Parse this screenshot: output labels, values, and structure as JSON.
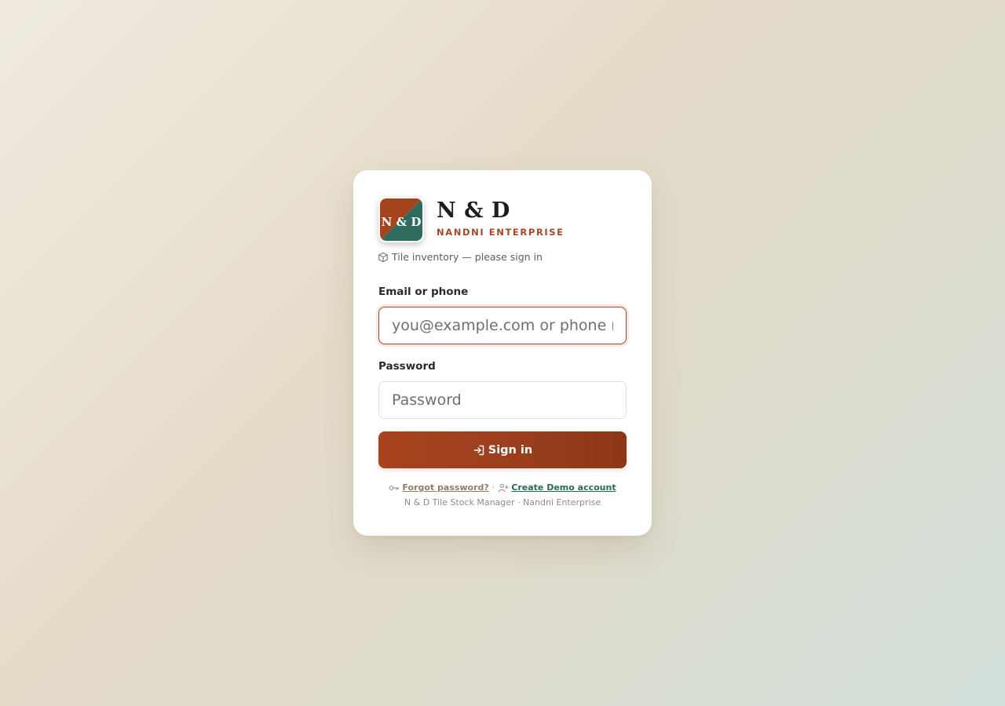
{
  "brand": {
    "logo_text": "N & D",
    "name": "N & D",
    "subtitle": "NANDNI ENTERPRISE",
    "colors": {
      "primary": "#a4482a",
      "secondary": "#2f6b5d"
    }
  },
  "tagline": {
    "icon": "cube-icon",
    "text": "Tile inventory — please sign in"
  },
  "form": {
    "email": {
      "label": "Email or phone",
      "placeholder": "you@example.com or phone number",
      "value": ""
    },
    "password": {
      "label": "Password",
      "placeholder": "Password",
      "value": ""
    },
    "submit": {
      "icon": "sign-in-icon",
      "label": "Sign in"
    }
  },
  "footer": {
    "forgot": {
      "icon": "key-icon",
      "label": "Forgot password?"
    },
    "separator": "·",
    "demo": {
      "icon": "add-user-icon",
      "label": "Create Demo account"
    },
    "note": "N & D Tile Stock Manager · Nandni Enterprise"
  }
}
